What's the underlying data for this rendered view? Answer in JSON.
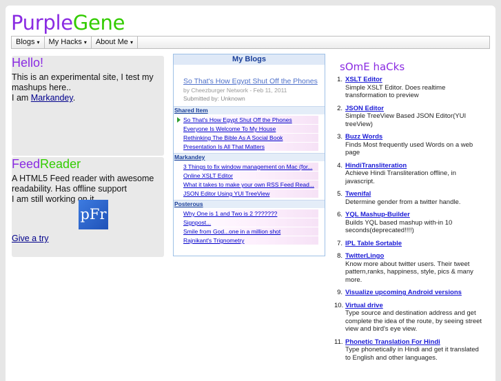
{
  "site": {
    "title_part1": "Purple",
    "title_part2": "Gene"
  },
  "menu": [
    {
      "label": "Blogs",
      "caret": "▾"
    },
    {
      "label": "My Hacks",
      "caret": "▾"
    },
    {
      "label": "About Me",
      "caret": "▾"
    }
  ],
  "hello": {
    "title": "Hello!",
    "text1": "This is an experimental site, I test my mashups here..",
    "text2": "I am ",
    "link": "Markandey",
    "text3": "."
  },
  "feed": {
    "title_part1": "Feed",
    "title_part2": "Reader",
    "desc": "A HTML5 Feed reader with awesome readability. Has offline support",
    "note": "I am still working on it.",
    "logo": "pFr",
    "link": "Give a try"
  },
  "blogs": {
    "heading": "My Blogs",
    "featured": {
      "title": "So That's How Egypt Shut Off the Phones",
      "meta": "by Cheezburger Network - Feb 11, 2011",
      "submitted": "Submitted by: Unknown"
    },
    "sections": [
      {
        "name": "Shared Item",
        "items": [
          "So That's How Egypt Shut Off the Phones",
          "Everyone Is Welcome To My House",
          "Rethinking The Bible As A Social Book",
          "Presentation Is All That Matters"
        ]
      },
      {
        "name": "Markandey",
        "items": [
          "3 Things to fix window management on Mac (for...",
          "Online XSLT Editor",
          "What it takes to make your own RSS Feed Read...",
          "JSON Editor Using YUI TreeView"
        ]
      },
      {
        "name": "Posterous",
        "items": [
          "Why One is 1 and Two is 2 ???????",
          "Signpost...",
          "Smile from God...one in a million shot",
          "Rajnikant's Trignometry"
        ]
      }
    ]
  },
  "hacks": {
    "title": "sOmE haCks",
    "items": [
      {
        "num": "1.",
        "name": "XSLT Editor",
        "desc": "Simple XSLT Editor. Does realtime transformation to preview"
      },
      {
        "num": "2.",
        "name": "JSON Editor",
        "desc": "Simple TreeView Based JSON Editor(YUI treeView)"
      },
      {
        "num": "3.",
        "name": "Buzz Words",
        "desc": "Finds Most frequently used Words on a web page"
      },
      {
        "num": "4.",
        "name": "HindiTransliteration",
        "desc": "Achieve Hindi Transliteration offline, in javascript."
      },
      {
        "num": "5.",
        "name": "Twenifal",
        "desc": "Determine gender from a twitter handle."
      },
      {
        "num": "6.",
        "name": "YQL Mashup-Builder",
        "desc": "Builds YQL based mashup with-in 10 seconds(deprecated!!!!)"
      },
      {
        "num": "7.",
        "name": "IPL Table Sortable",
        "desc": ""
      },
      {
        "num": "8.",
        "name": "TwitterLingo",
        "desc": "Know more about twitter users. Their tweet pattern,ranks, happiness, style, pics & many more."
      },
      {
        "num": "9.",
        "name": "Visualize upcoming Android versions",
        "desc": ""
      },
      {
        "num": "10.",
        "name": "Virtual drive",
        "desc": "Type source and destination address and get complete the idea of the route, by seeing street view and bird's eye view."
      },
      {
        "num": "11.",
        "name": "Phonetic Translation For Hindi",
        "desc": "Type phonetically in Hindi and get it translated to English and other languages."
      }
    ]
  }
}
